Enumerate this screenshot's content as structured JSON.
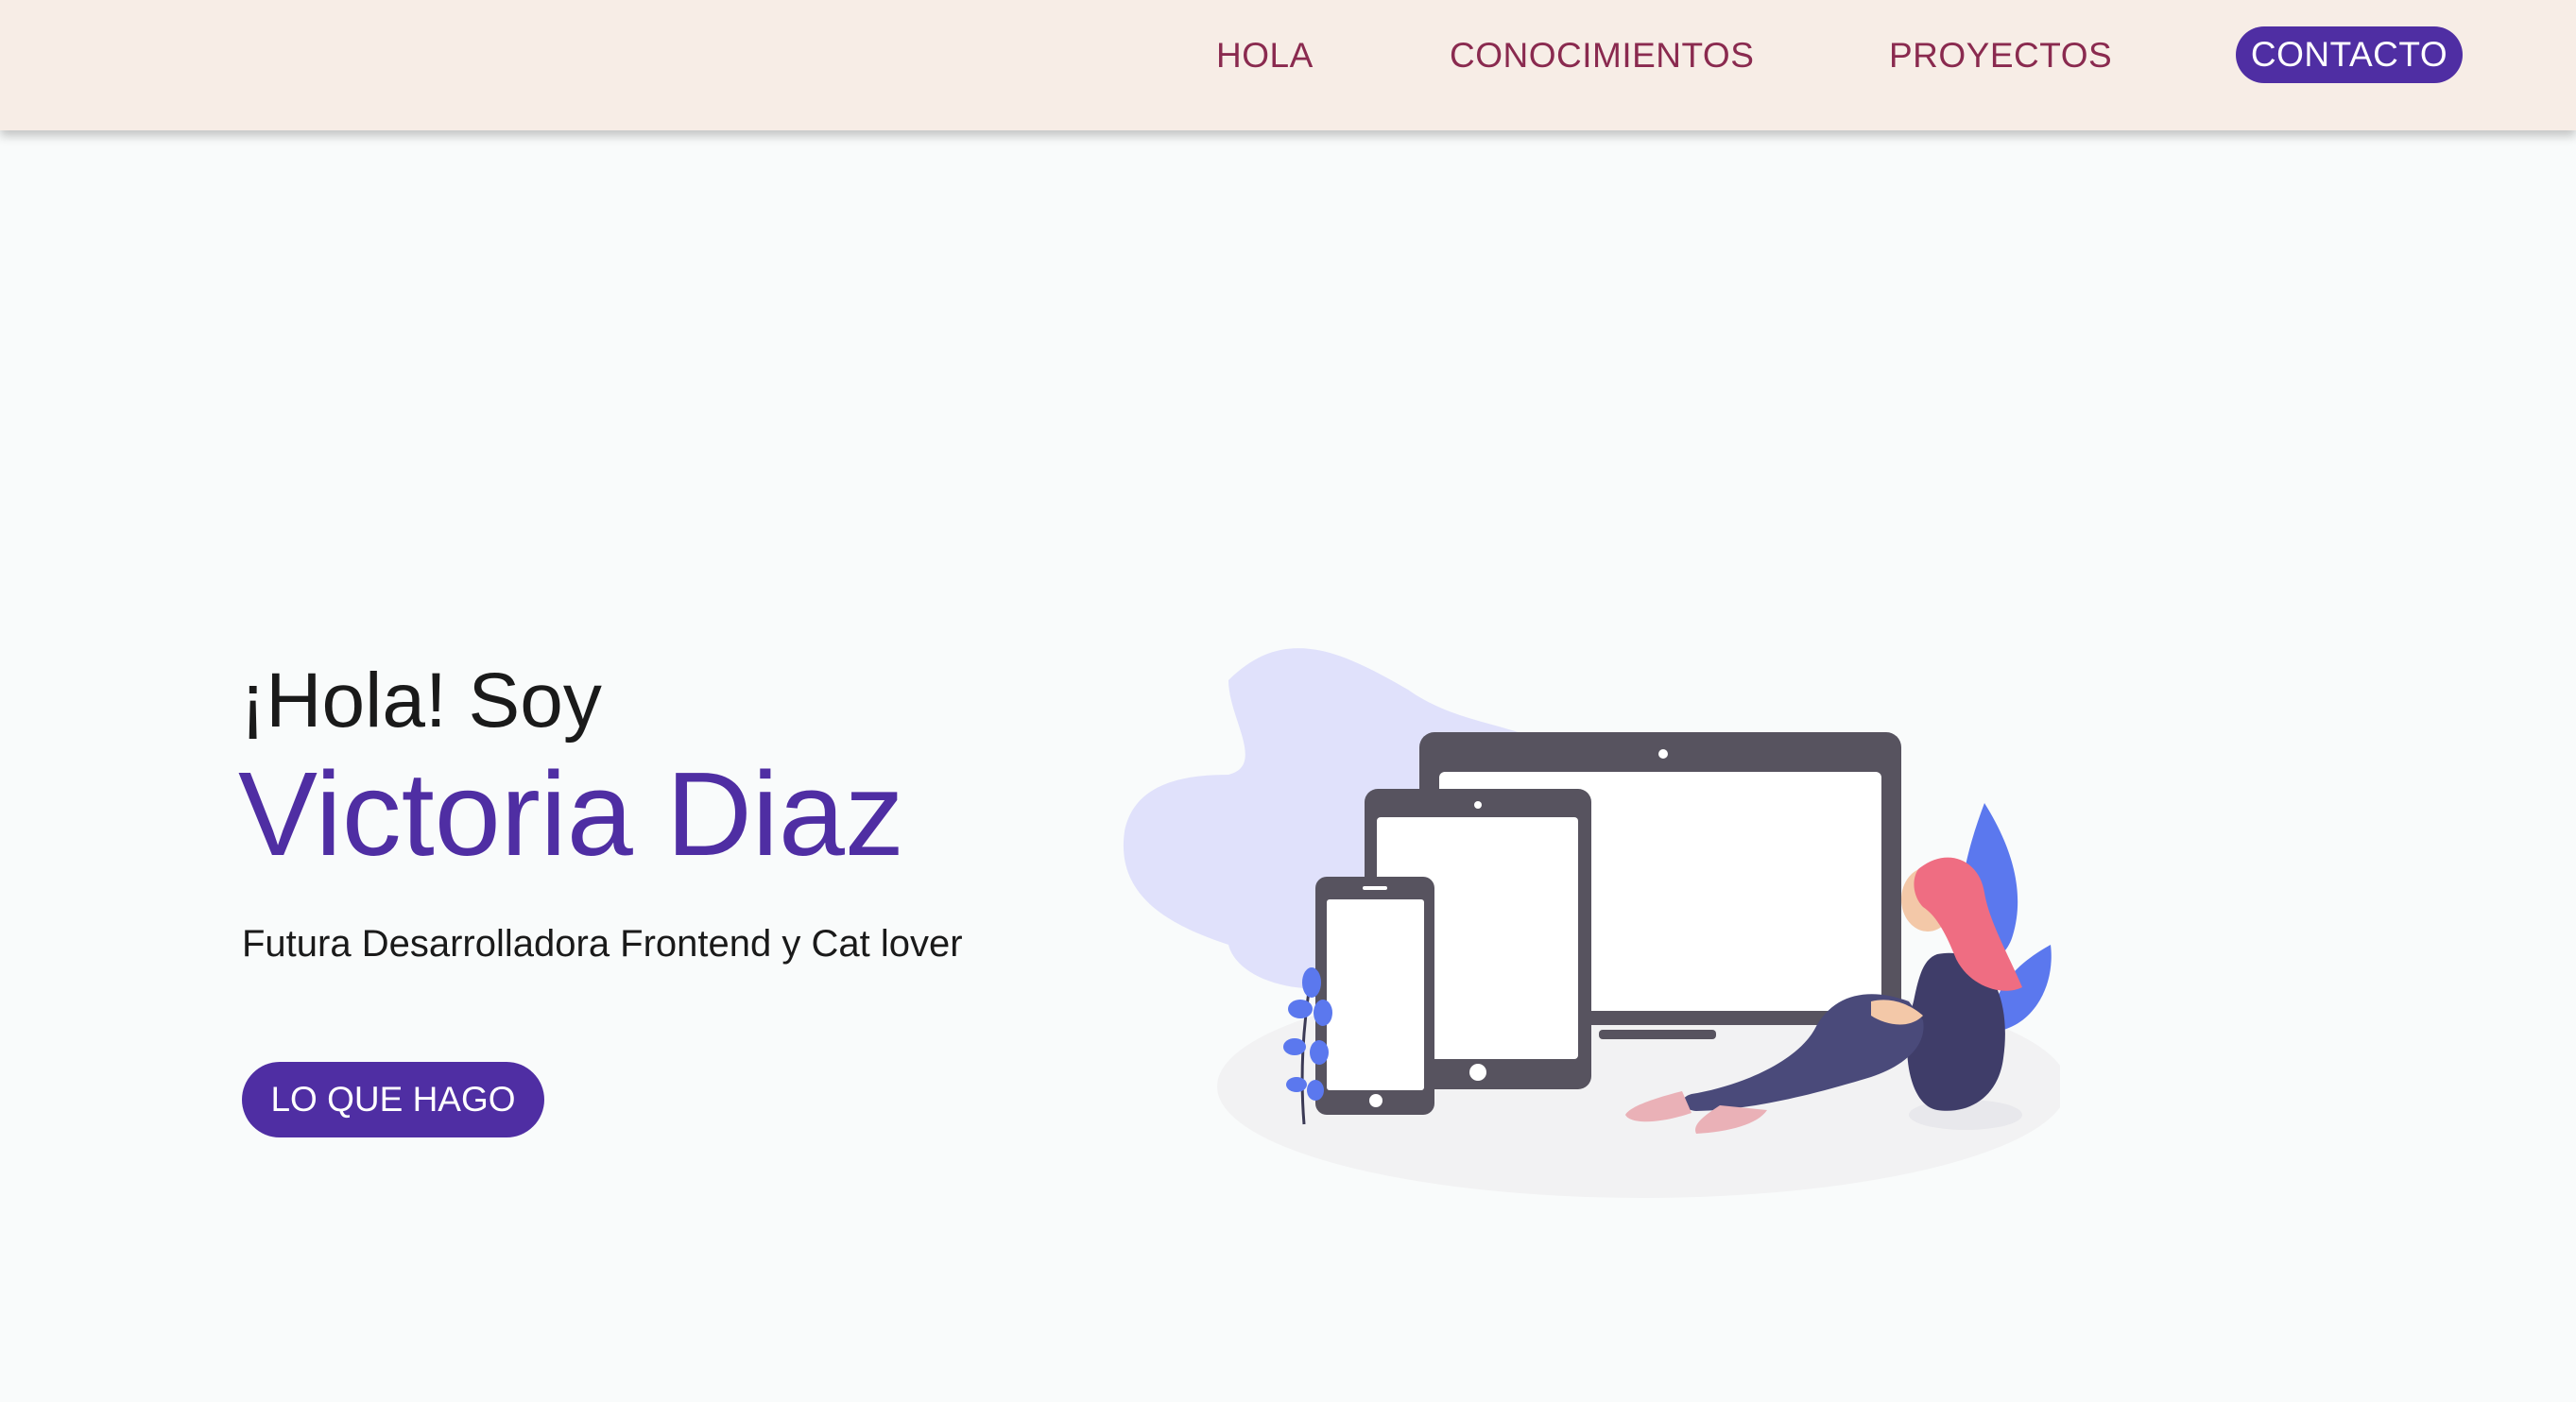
{
  "nav": {
    "links": [
      {
        "label": "HOLA"
      },
      {
        "label": "CONOCIMIENTOS"
      },
      {
        "label": "PROYECTOS"
      }
    ],
    "contact_label": "CONTACTO"
  },
  "hero": {
    "greeting": "¡Hola! Soy",
    "name": "Victoria Diaz",
    "subtitle": "Futura Desarrolladora Frontend y Cat lover",
    "cta_label": "LO QUE HAGO"
  },
  "illustration": {
    "semantic": "devices-illustration"
  },
  "colors": {
    "navbar_background": "#f7ede6",
    "nav_link": "#8a2a4f",
    "accent": "#4f2ea3",
    "page_background": "#f9fbfb",
    "text": "#1a1a1a"
  }
}
